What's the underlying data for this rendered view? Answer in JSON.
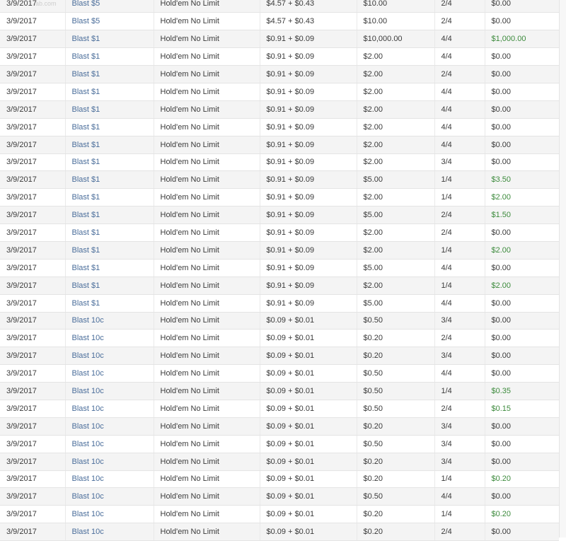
{
  "watermark": "ab.com",
  "colors": {
    "link": "#4a6d9a",
    "won_positive": "#3c8a3c",
    "row_alt": "#f4f4f4"
  },
  "rows": [
    {
      "date": "3/9/2017",
      "game": "Blast $5",
      "type": "Hold'em No Limit",
      "buyin": "$4.57 + $0.43",
      "prize": "$10.00",
      "place": "2/4",
      "won": "$0.00"
    },
    {
      "date": "3/9/2017",
      "game": "Blast $5",
      "type": "Hold'em No Limit",
      "buyin": "$4.57 + $0.43",
      "prize": "$10.00",
      "place": "2/4",
      "won": "$0.00"
    },
    {
      "date": "3/9/2017",
      "game": "Blast $1",
      "type": "Hold'em No Limit",
      "buyin": "$0.91 + $0.09",
      "prize": "$10,000.00",
      "place": "4/4",
      "won": "$1,000.00"
    },
    {
      "date": "3/9/2017",
      "game": "Blast $1",
      "type": "Hold'em No Limit",
      "buyin": "$0.91 + $0.09",
      "prize": "$2.00",
      "place": "4/4",
      "won": "$0.00"
    },
    {
      "date": "3/9/2017",
      "game": "Blast $1",
      "type": "Hold'em No Limit",
      "buyin": "$0.91 + $0.09",
      "prize": "$2.00",
      "place": "2/4",
      "won": "$0.00"
    },
    {
      "date": "3/9/2017",
      "game": "Blast $1",
      "type": "Hold'em No Limit",
      "buyin": "$0.91 + $0.09",
      "prize": "$2.00",
      "place": "4/4",
      "won": "$0.00"
    },
    {
      "date": "3/9/2017",
      "game": "Blast $1",
      "type": "Hold'em No Limit",
      "buyin": "$0.91 + $0.09",
      "prize": "$2.00",
      "place": "4/4",
      "won": "$0.00"
    },
    {
      "date": "3/9/2017",
      "game": "Blast $1",
      "type": "Hold'em No Limit",
      "buyin": "$0.91 + $0.09",
      "prize": "$2.00",
      "place": "4/4",
      "won": "$0.00"
    },
    {
      "date": "3/9/2017",
      "game": "Blast $1",
      "type": "Hold'em No Limit",
      "buyin": "$0.91 + $0.09",
      "prize": "$2.00",
      "place": "4/4",
      "won": "$0.00"
    },
    {
      "date": "3/9/2017",
      "game": "Blast $1",
      "type": "Hold'em No Limit",
      "buyin": "$0.91 + $0.09",
      "prize": "$2.00",
      "place": "3/4",
      "won": "$0.00"
    },
    {
      "date": "3/9/2017",
      "game": "Blast $1",
      "type": "Hold'em No Limit",
      "buyin": "$0.91 + $0.09",
      "prize": "$5.00",
      "place": "1/4",
      "won": "$3.50"
    },
    {
      "date": "3/9/2017",
      "game": "Blast $1",
      "type": "Hold'em No Limit",
      "buyin": "$0.91 + $0.09",
      "prize": "$2.00",
      "place": "1/4",
      "won": "$2.00"
    },
    {
      "date": "3/9/2017",
      "game": "Blast $1",
      "type": "Hold'em No Limit",
      "buyin": "$0.91 + $0.09",
      "prize": "$5.00",
      "place": "2/4",
      "won": "$1.50"
    },
    {
      "date": "3/9/2017",
      "game": "Blast $1",
      "type": "Hold'em No Limit",
      "buyin": "$0.91 + $0.09",
      "prize": "$2.00",
      "place": "2/4",
      "won": "$0.00"
    },
    {
      "date": "3/9/2017",
      "game": "Blast $1",
      "type": "Hold'em No Limit",
      "buyin": "$0.91 + $0.09",
      "prize": "$2.00",
      "place": "1/4",
      "won": "$2.00"
    },
    {
      "date": "3/9/2017",
      "game": "Blast $1",
      "type": "Hold'em No Limit",
      "buyin": "$0.91 + $0.09",
      "prize": "$5.00",
      "place": "4/4",
      "won": "$0.00"
    },
    {
      "date": "3/9/2017",
      "game": "Blast $1",
      "type": "Hold'em No Limit",
      "buyin": "$0.91 + $0.09",
      "prize": "$2.00",
      "place": "1/4",
      "won": "$2.00"
    },
    {
      "date": "3/9/2017",
      "game": "Blast $1",
      "type": "Hold'em No Limit",
      "buyin": "$0.91 + $0.09",
      "prize": "$5.00",
      "place": "4/4",
      "won": "$0.00"
    },
    {
      "date": "3/9/2017",
      "game": "Blast 10c",
      "type": "Hold'em No Limit",
      "buyin": "$0.09 + $0.01",
      "prize": "$0.50",
      "place": "3/4",
      "won": "$0.00"
    },
    {
      "date": "3/9/2017",
      "game": "Blast 10c",
      "type": "Hold'em No Limit",
      "buyin": "$0.09 + $0.01",
      "prize": "$0.20",
      "place": "2/4",
      "won": "$0.00"
    },
    {
      "date": "3/9/2017",
      "game": "Blast 10c",
      "type": "Hold'em No Limit",
      "buyin": "$0.09 + $0.01",
      "prize": "$0.20",
      "place": "3/4",
      "won": "$0.00"
    },
    {
      "date": "3/9/2017",
      "game": "Blast 10c",
      "type": "Hold'em No Limit",
      "buyin": "$0.09 + $0.01",
      "prize": "$0.50",
      "place": "4/4",
      "won": "$0.00"
    },
    {
      "date": "3/9/2017",
      "game": "Blast 10c",
      "type": "Hold'em No Limit",
      "buyin": "$0.09 + $0.01",
      "prize": "$0.50",
      "place": "1/4",
      "won": "$0.35"
    },
    {
      "date": "3/9/2017",
      "game": "Blast 10c",
      "type": "Hold'em No Limit",
      "buyin": "$0.09 + $0.01",
      "prize": "$0.50",
      "place": "2/4",
      "won": "$0.15"
    },
    {
      "date": "3/9/2017",
      "game": "Blast 10c",
      "type": "Hold'em No Limit",
      "buyin": "$0.09 + $0.01",
      "prize": "$0.20",
      "place": "3/4",
      "won": "$0.00"
    },
    {
      "date": "3/9/2017",
      "game": "Blast 10c",
      "type": "Hold'em No Limit",
      "buyin": "$0.09 + $0.01",
      "prize": "$0.50",
      "place": "3/4",
      "won": "$0.00"
    },
    {
      "date": "3/9/2017",
      "game": "Blast 10c",
      "type": "Hold'em No Limit",
      "buyin": "$0.09 + $0.01",
      "prize": "$0.20",
      "place": "3/4",
      "won": "$0.00"
    },
    {
      "date": "3/9/2017",
      "game": "Blast 10c",
      "type": "Hold'em No Limit",
      "buyin": "$0.09 + $0.01",
      "prize": "$0.20",
      "place": "1/4",
      "won": "$0.20"
    },
    {
      "date": "3/9/2017",
      "game": "Blast 10c",
      "type": "Hold'em No Limit",
      "buyin": "$0.09 + $0.01",
      "prize": "$0.50",
      "place": "4/4",
      "won": "$0.00"
    },
    {
      "date": "3/9/2017",
      "game": "Blast 10c",
      "type": "Hold'em No Limit",
      "buyin": "$0.09 + $0.01",
      "prize": "$0.20",
      "place": "1/4",
      "won": "$0.20"
    },
    {
      "date": "3/9/2017",
      "game": "Blast 10c",
      "type": "Hold'em No Limit",
      "buyin": "$0.09 + $0.01",
      "prize": "$0.20",
      "place": "2/4",
      "won": "$0.00"
    }
  ]
}
